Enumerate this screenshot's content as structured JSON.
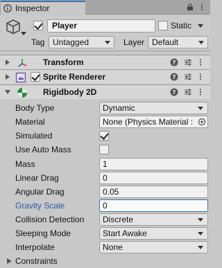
{
  "tab": {
    "label": "Inspector"
  },
  "object": {
    "active": true,
    "name": "Player",
    "static_label": "Static",
    "static": false,
    "tag_label": "Tag",
    "tag_value": "Untagged",
    "layer_label": "Layer",
    "layer_value": "Default"
  },
  "components": [
    {
      "title": "Transform"
    },
    {
      "title": "Sprite Renderer",
      "enabled": true
    },
    {
      "title": "Rigidbody 2D"
    }
  ],
  "rigidbody": {
    "body_type": {
      "label": "Body Type",
      "value": "Dynamic"
    },
    "material": {
      "label": "Material",
      "value": "None (Physics Material :"
    },
    "simulated": {
      "label": "Simulated",
      "value": true
    },
    "use_auto_mass": {
      "label": "Use Auto Mass",
      "value": false
    },
    "mass": {
      "label": "Mass",
      "value": "1"
    },
    "linear_drag": {
      "label": "Linear Drag",
      "value": "0"
    },
    "angular_drag": {
      "label": "Angular Drag",
      "value": "0.05"
    },
    "gravity_scale": {
      "label": "Gravity Scale",
      "value": "0"
    },
    "collision_detection": {
      "label": "Collision Detection",
      "value": "Discrete"
    },
    "sleeping_mode": {
      "label": "Sleeping Mode",
      "value": "Start Awake"
    },
    "interpolate": {
      "label": "Interpolate",
      "value": "None"
    },
    "constraints": {
      "label": "Constraints"
    }
  },
  "colors": {
    "accent": "#3a72b0",
    "label_blue": "#2f56a8"
  }
}
